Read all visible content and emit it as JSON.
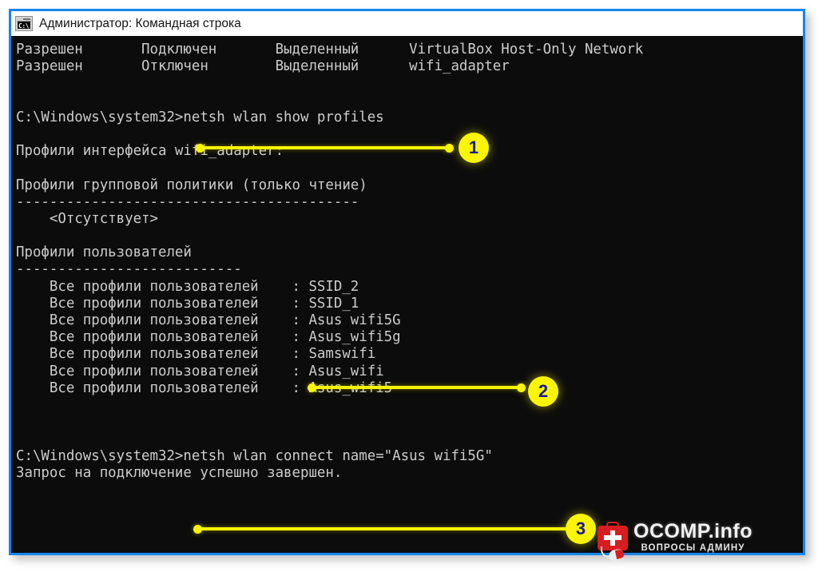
{
  "window": {
    "title": "Администратор: Командная строка",
    "icon": "cmd-icon",
    "icon_text": "C:\\",
    "border_color": "#1486f0",
    "titlebar_bg": "#ffffff",
    "terminal_bg": "#0c0c0c",
    "terminal_fg": "#cccccc"
  },
  "terminal": {
    "lines": [
      "Разрешен       Подключен       Выделенный      VirtualBox Host-Only Network",
      "Разрешен       Отключен        Выделенный      wifi_adapter",
      "",
      "",
      "C:\\Windows\\system32>netsh wlan show profiles",
      "",
      "Профили интерфейса wifi_adapter:",
      "",
      "Профили групповой политики (только чтение)",
      "-----------------------------------------",
      "    <Отсутствует>",
      "",
      "Профили пользователей",
      "---------------------------",
      "    Все профили пользователей    : SSID_2",
      "    Все профили пользователей    : SSID_1",
      "    Все профили пользователей    : Asus wifi5G",
      "    Все профили пользователей    : Asus_wifi5g",
      "    Все профили пользователей    : Samswifi",
      "    Все профили пользователей    : Asus_wifi",
      "    Все профили пользователей    : Asus_wifi5",
      "",
      "",
      "",
      "C:\\Windows\\system32>netsh wlan connect name=\"Asus wifi5G\"",
      "Запрос на подключение успешно завершен."
    ],
    "commands": [
      "netsh wlan show profiles",
      "netsh wlan connect name=\"Asus wifi5G\""
    ],
    "profiles": [
      "SSID_2",
      "SSID_1",
      "Asus wifi5G",
      "Asus_wifi5g",
      "Samswifi",
      "Asus_wifi",
      "Asus_wifi5"
    ],
    "interface": "wifi_adapter",
    "result_message": "Запрос на подключение успешно завершен."
  },
  "annotations": {
    "color": "#fbf500",
    "number_color": "#1b1b8f",
    "items": [
      {
        "label": "1"
      },
      {
        "label": "2"
      },
      {
        "label": "3"
      }
    ]
  },
  "watermark": {
    "brand": "OCOMP.info",
    "tagline": "ВОПРОСЫ АДМИНУ",
    "accent": "#d81d21"
  }
}
